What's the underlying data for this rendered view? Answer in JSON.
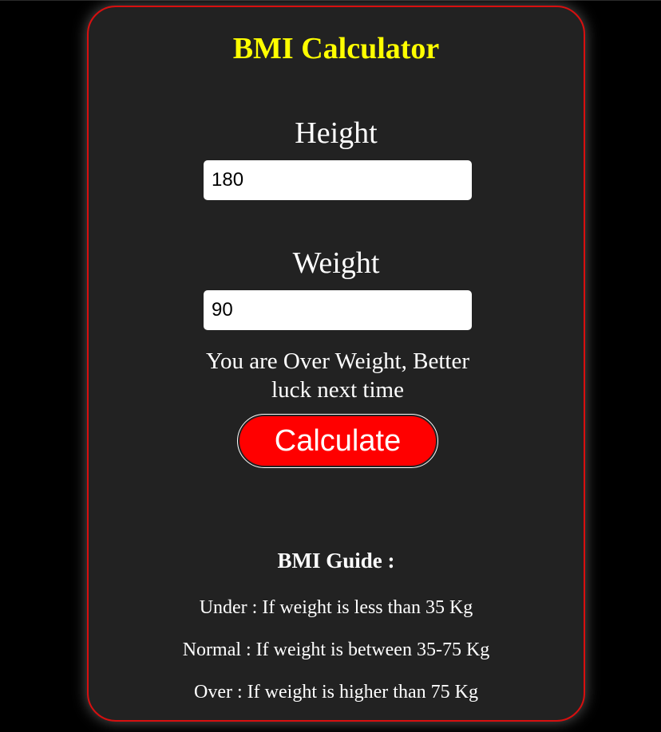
{
  "app": {
    "title": "BMI Calculator"
  },
  "form": {
    "height_label": "Height",
    "height_value": "180",
    "weight_label": "Weight",
    "weight_value": "90",
    "result_text": "You are Over Weight, Better luck next time",
    "calculate_label": "Calculate"
  },
  "guide": {
    "title": "BMI Guide :",
    "items": [
      "Under : If weight is less than 35 Kg",
      "Normal : If weight is between 35-75 Kg",
      "Over : If weight is higher than 75 Kg"
    ]
  },
  "colors": {
    "background": "#000000",
    "card": "#222222",
    "border": "#d80f0f",
    "title": "#ffff00",
    "button": "#ff0000"
  }
}
